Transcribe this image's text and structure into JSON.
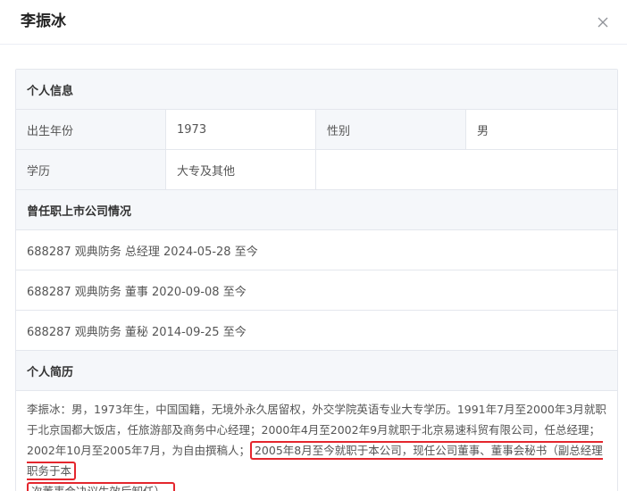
{
  "dialog": {
    "title": "李振冰",
    "close_icon": "close-icon"
  },
  "personal_info": {
    "section_title": "个人信息",
    "birth_year_label": "出生年份",
    "birth_year_value": "1973",
    "gender_label": "性别",
    "gender_value": "男",
    "education_label": "学历",
    "education_value": "大专及其他"
  },
  "positions": {
    "section_title": "曾任职上市公司情况",
    "items": [
      "688287 观典防务 总经理 2024-05-28 至今",
      "688287 观典防务 董事 2020-09-08 至今",
      "688287 观典防务 董秘 2014-09-25 至今"
    ]
  },
  "bio": {
    "section_title": "个人简历",
    "text_plain": "李振冰：男，1973年生，中国国籍，无境外永久居留权，外交学院英语专业大专学历。1991年7月至2000年3月就职于北京国都大饭店，任旅游部及商务中心经理；2000年4月至2002年9月就职于北京易速科贸有限公司，任总经理；2002年10月至2005年7月，为自由撰稿人；",
    "text_highlight_1": "2005年8月至今就职于本公司，现任公司董事、董事会秘书（副总经理职务于本",
    "text_highlight_2": "次董事会决议生效后卸任）。",
    "highlight_color": "#e4262d"
  }
}
